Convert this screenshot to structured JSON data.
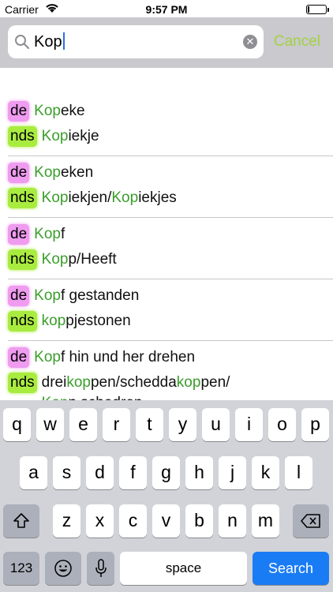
{
  "status_bar": {
    "carrier": "Carrier",
    "time": "9:57 PM"
  },
  "search": {
    "query": "Kop",
    "cancel_label": "Cancel"
  },
  "colors": {
    "accent": "#a3d140",
    "match": "#3a9e2a",
    "de_tag": "#ef9bef",
    "nds_tag": "#a9ec40",
    "search_key": "#1a7cf5"
  },
  "results": [
    {
      "de_tag": "de",
      "de": [
        "Kop",
        "eke",
        ""
      ],
      "nds_tag": "nds",
      "nds": [
        "",
        "Kop",
        "iekje"
      ]
    },
    {
      "de_tag": "de",
      "de": [
        "Kop",
        "eken",
        ""
      ],
      "nds_tag": "nds",
      "nds": [
        "",
        "Kop",
        "iekjen/",
        "Kop",
        "iekjes"
      ]
    },
    {
      "de_tag": "de",
      "de": [
        "Kop",
        "f",
        ""
      ],
      "nds_tag": "nds",
      "nds": [
        "",
        "Kop",
        "p/Heeft"
      ]
    },
    {
      "de_tag": "de",
      "de": [
        "Kop",
        "f gestanden",
        ""
      ],
      "nds_tag": "nds",
      "nds": [
        "",
        "kop",
        "pjestonen"
      ]
    },
    {
      "de_tag": "de",
      "de": [
        "Kop",
        "f hin und her drehen",
        ""
      ],
      "nds_tag": "nds",
      "nds": [
        "drei",
        "kop",
        "pen/schedda",
        "kop",
        "pen/",
        "Kop",
        "p schedren"
      ]
    }
  ],
  "keyboard": {
    "row1": [
      "q",
      "w",
      "e",
      "r",
      "t",
      "y",
      "u",
      "i",
      "o",
      "p"
    ],
    "row2": [
      "a",
      "s",
      "d",
      "f",
      "g",
      "h",
      "j",
      "k",
      "l"
    ],
    "row3": [
      "z",
      "x",
      "c",
      "v",
      "b",
      "n",
      "m"
    ],
    "numbers_label": "123",
    "space_label": "space",
    "search_label": "Search"
  }
}
